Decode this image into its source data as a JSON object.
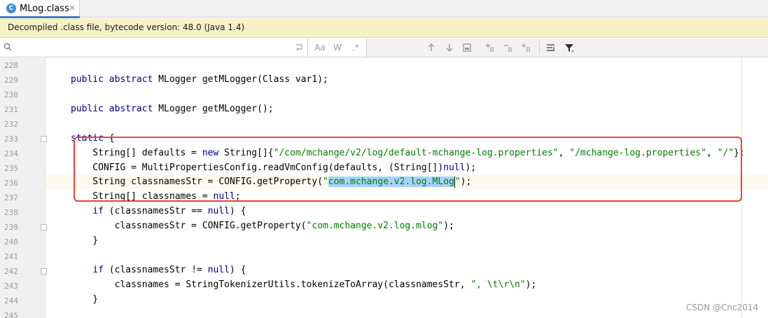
{
  "tab": {
    "icon_letter": "C",
    "label": "MLog.class",
    "close": "×"
  },
  "banner": {
    "text": "Decompiled .class file, bytecode version: 48.0 (Java 1.4)"
  },
  "search": {
    "value": "",
    "placeholder": "",
    "tools": [
      "Aa",
      "W",
      ".*"
    ]
  },
  "toolbar_icons": [
    "up-arrow-icon",
    "down-arrow-icon",
    "select-all-occurrences-icon",
    "add-selection-icon",
    "remove-selection-icon",
    "select-all-icon",
    "filter-lines-icon",
    "filter-icon"
  ],
  "colors": {
    "keyword": "#000080",
    "string": "#008000",
    "box": "#e0453e",
    "selection": "#a6d2ff",
    "tab_accent": "#4083c9"
  },
  "editor": {
    "line_numbers": [
      "228",
      "229",
      "230",
      "231",
      "232",
      "233",
      "234",
      "235",
      "236",
      "237",
      "238",
      "239",
      "240",
      "241",
      "242",
      "243",
      "244",
      "245"
    ],
    "lines": {
      "l229": {
        "kw": "public abstract",
        "rest": " MLogger getMLogger(Class var1);"
      },
      "l231": {
        "kw": "public abstract",
        "rest": " MLogger getMLogger();"
      },
      "l233": {
        "kw": "static",
        "rest": " {"
      },
      "l234": {
        "a": "    String[] defaults = ",
        "kw": "new",
        "b": " String[]{",
        "s1": "\"/com/mchange/v2/log/default-mchange-log.properties\"",
        "c": ", ",
        "s2": "\"/mchange-log.properties\"",
        "d": ", ",
        "s3": "\"/\"",
        "e": "};"
      },
      "l235": {
        "a": "    CONFIG = MultiPropertiesConfig.readVmConfig(defaults, (String[])",
        "kw": "null",
        "b": ");"
      },
      "l236": {
        "a": "    String classnamesStr = CONFIG.getProperty(",
        "q1": "\"",
        "sel": "com.mchange.v2.log.MLog",
        "q2": "\"",
        "b": ");"
      },
      "l237": {
        "a": "    String[] classnames = ",
        "kw": "null",
        "b": ";"
      },
      "l238": {
        "a": "    ",
        "kw": "if",
        "b": " (classnamesStr == ",
        "kw2": "null",
        "c": ") {"
      },
      "l239": {
        "a": "        classnamesStr = CONFIG.getProperty(",
        "s": "\"com.mchange.v2.log.mlog\"",
        "b": ");"
      },
      "l240": {
        "a": "    }"
      },
      "l242": {
        "a": "    ",
        "kw": "if",
        "b": " (classnamesStr != ",
        "kw2": "null",
        "c": ") {"
      },
      "l243": {
        "a": "        classnames = StringTokenizerUtils.tokenizeToArray(classnamesStr, ",
        "s": "\", \\t\\r\\n\"",
        "b": ");"
      },
      "l244": {
        "a": "    }"
      }
    }
  },
  "watermark": "CSDN @Cnc2014"
}
